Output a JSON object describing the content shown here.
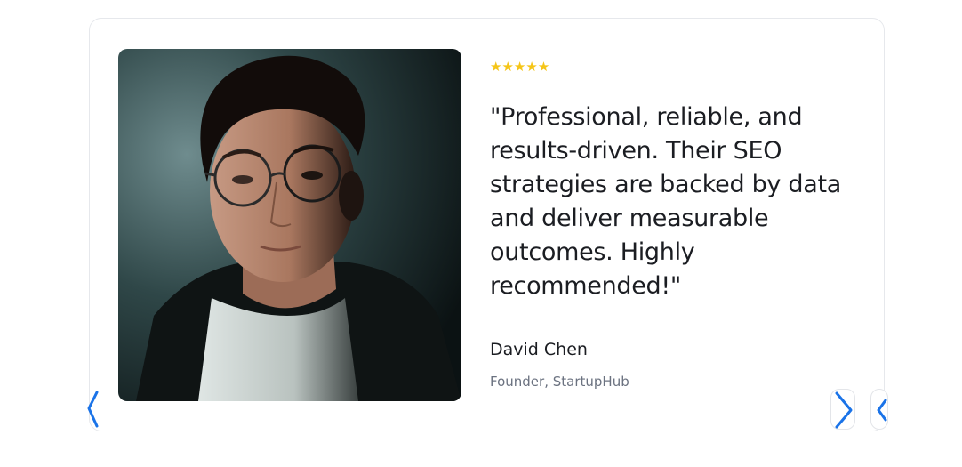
{
  "testimonial": {
    "rating_stars": "★★★★★",
    "quote": "\"Professional, reliable, and results-driven. Their SEO strategies are backed by data and deliver measurable outcomes. Highly recommended!\"",
    "author_name": "David Chen",
    "author_role": "Founder, StartupHub",
    "photo_icon": "portrait-photo"
  },
  "navigation": {
    "prev_icon": "chevron-left-icon",
    "next_icon": "chevron-right-icon",
    "accent_color": "#1a73e8"
  },
  "colors": {
    "star": "#f5c518",
    "text": "#1b1d22",
    "muted": "#6b7280"
  }
}
